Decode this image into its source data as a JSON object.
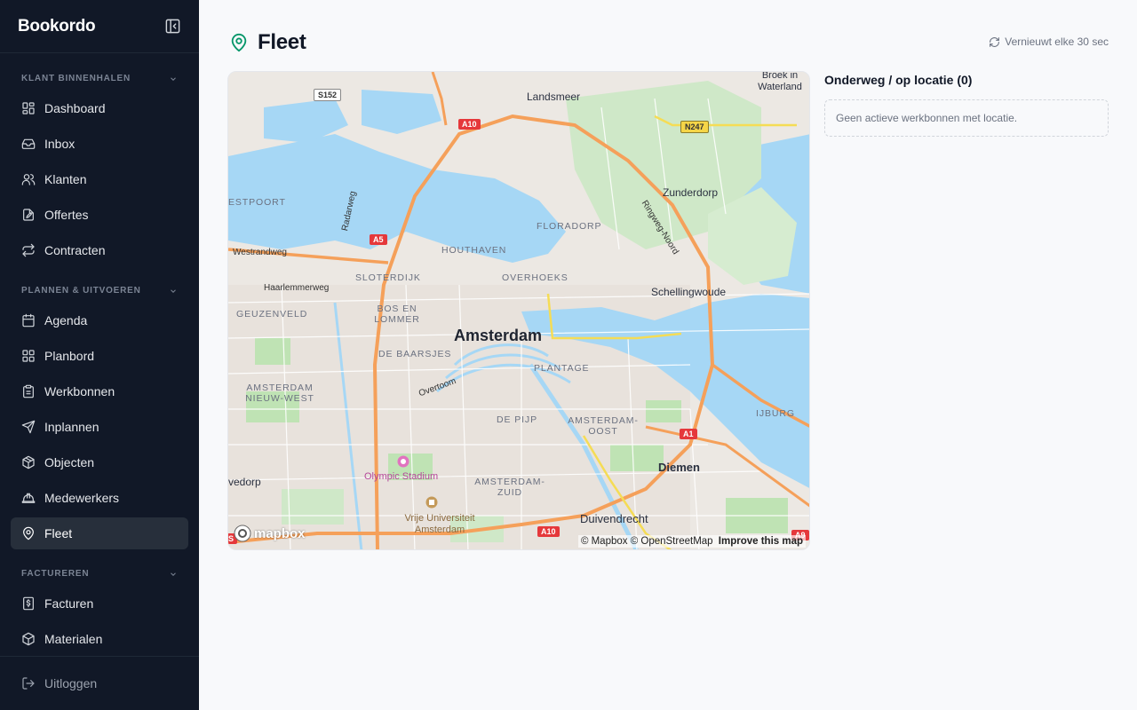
{
  "app": {
    "name": "Bookordo"
  },
  "sidebar": {
    "sections": [
      {
        "title": "KLANT BINNENHALEN",
        "items": [
          {
            "label": "Dashboard",
            "icon": "dashboard-icon"
          },
          {
            "label": "Inbox",
            "icon": "inbox-icon"
          },
          {
            "label": "Klanten",
            "icon": "users-icon"
          },
          {
            "label": "Offertes",
            "icon": "quote-icon"
          },
          {
            "label": "Contracten",
            "icon": "repeat-icon"
          }
        ]
      },
      {
        "title": "PLANNEN & UITVOEREN",
        "items": [
          {
            "label": "Agenda",
            "icon": "calendar-icon"
          },
          {
            "label": "Planbord",
            "icon": "grid-icon"
          },
          {
            "label": "Werkbonnen",
            "icon": "clipboard-icon"
          },
          {
            "label": "Inplannen",
            "icon": "send-icon"
          },
          {
            "label": "Objecten",
            "icon": "cube-icon"
          },
          {
            "label": "Medewerkers",
            "icon": "hardhat-icon"
          },
          {
            "label": "Fleet",
            "icon": "map-pin-icon",
            "active": true
          }
        ]
      },
      {
        "title": "FACTUREREN",
        "items": [
          {
            "label": "Facturen",
            "icon": "invoice-icon"
          },
          {
            "label": "Materialen",
            "icon": "package-icon"
          }
        ]
      }
    ],
    "logout": "Uitloggen"
  },
  "page": {
    "title": "Fleet",
    "refresh_label": "Vernieuwt elke 30 sec",
    "accent": "#059669"
  },
  "map": {
    "labels": {
      "amsterdam": "Amsterdam",
      "landsmeer": "Landsmeer",
      "broek": "Broek in Waterland",
      "zunderdorp": "Zunderdorp",
      "schellingwoude": "Schellingwoude",
      "diemen": "Diemen",
      "duivendrecht": "Duivendrecht",
      "westpoort": "ESTPOORT",
      "floradorp": "FLORADORP",
      "houthaven": "HOUTHAVEN",
      "sloterdijk": "SLOTERDIJK",
      "overhoeks": "OVERHOEKS",
      "geuzenveld": "GEUZENVELD",
      "bos_en_lommer": "BOS EN LOMMER",
      "de_baarsjes": "DE BAARSJES",
      "plantage": "PLANTAGE",
      "amsterdam_nieuw_west": "AMSTERDAM NIEUW-WEST",
      "de_pijp": "DE PIJP",
      "amsterdam_oost": "AMSTERDAM-OOST",
      "ijburg": "IJBURG",
      "amsterdam_zuid": "AMSTERDAM-ZUID",
      "osdorp": "vedorp",
      "olympic": "Olympic Stadium",
      "vu": "Vrije Universiteit Amsterdam",
      "westrandweg": "Westrandweg",
      "haarlemmerweg": "Haarlemmerweg",
      "radarweg": "Radarweg",
      "ringweg": "Ringweg-Noord",
      "overtoom": "Overtoom"
    },
    "shields": {
      "s152": "S152",
      "a10_top": "A10",
      "n247": "N247",
      "a5": "A5",
      "a1": "A1",
      "a10_bottom": "A10",
      "a9": "A9",
      "s_left": "S"
    },
    "attribution": "© Mapbox © OpenStreetMap",
    "improve": "Improve this map",
    "logo": "mapbox"
  },
  "panel": {
    "title": "Onderweg / op locatie (0)",
    "empty": "Geen actieve werkbonnen met locatie."
  }
}
